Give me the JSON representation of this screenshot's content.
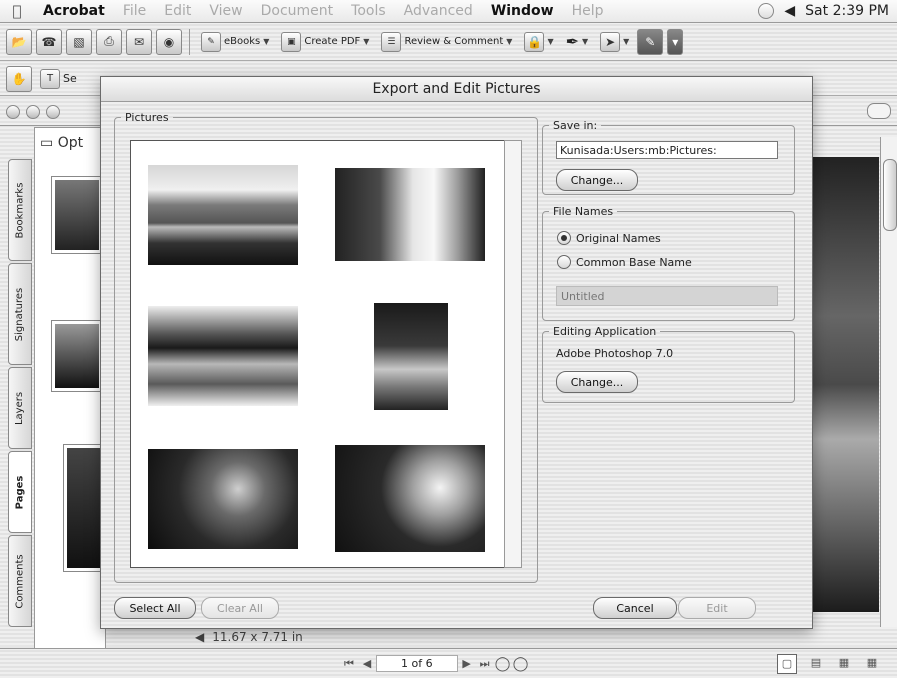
{
  "menubar": {
    "app": "Acrobat",
    "items": [
      "File",
      "Edit",
      "View",
      "Document",
      "Tools",
      "Advanced",
      "Window",
      "Help"
    ],
    "active": "Window",
    "clock": "Sat 2:39 PM"
  },
  "toolbar": {
    "ebooks": "eBooks",
    "create_pdf": "Create PDF",
    "review_comment": "Review & Comment",
    "select_text_partial": "Se"
  },
  "doc": {
    "options_label": "Opt",
    "side_tabs": [
      "Bookmarks",
      "Signatures",
      "Layers",
      "Pages",
      "Comments"
    ],
    "active_tab": "Pages",
    "page_size": "11.67 x 7.71 in"
  },
  "status": {
    "page_indicator": "1 of 6"
  },
  "dialog": {
    "title": "Export and Edit Pictures",
    "pictures_label": "Pictures",
    "save_in": {
      "label": "Save in:",
      "path": "Kunisada:Users:mb:Pictures:",
      "change_label": "Change..."
    },
    "file_names": {
      "label": "File Names",
      "options": [
        "Original Names",
        "Common Base Name"
      ],
      "selected": "Original Names",
      "base_name_value": "Untitled"
    },
    "editing_app": {
      "label": "Editing Application",
      "app": "Adobe Photoshop 7.0",
      "change_label": "Change..."
    },
    "buttons": {
      "select_all": "Select All",
      "clear_all": "Clear All",
      "cancel": "Cancel",
      "edit": "Edit"
    }
  }
}
